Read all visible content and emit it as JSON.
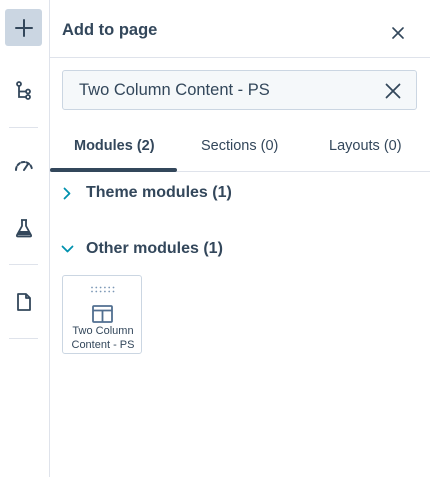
{
  "rail": {
    "items": [
      {
        "name": "add-icon",
        "active": true
      },
      {
        "name": "tree-icon",
        "active": false
      },
      {
        "name": "gauge-icon",
        "active": false
      },
      {
        "name": "flask-icon",
        "active": false
      },
      {
        "name": "document-icon",
        "active": false
      }
    ]
  },
  "panel": {
    "title": "Add to page",
    "close_icon": "close-icon"
  },
  "search": {
    "value": "Two Column Content - PS",
    "clear_icon": "clear-icon"
  },
  "tabs": [
    {
      "label": "Modules (2)",
      "active": true
    },
    {
      "label": "Sections (0)",
      "active": false
    },
    {
      "label": "Layouts (0)",
      "active": false
    }
  ],
  "groups": [
    {
      "label": "Theme modules (1)",
      "expanded": false
    },
    {
      "label": "Other modules (1)",
      "expanded": true
    }
  ],
  "modules": [
    {
      "label": "Two Column Content - PS",
      "icon": "two-column-layout-icon"
    }
  ],
  "colors": {
    "text": "#33475b",
    "border": "#dfe3eb",
    "active_rail_bg": "#cbd6e2",
    "chevron": "#0091ae",
    "module_icon": "#516f90"
  }
}
